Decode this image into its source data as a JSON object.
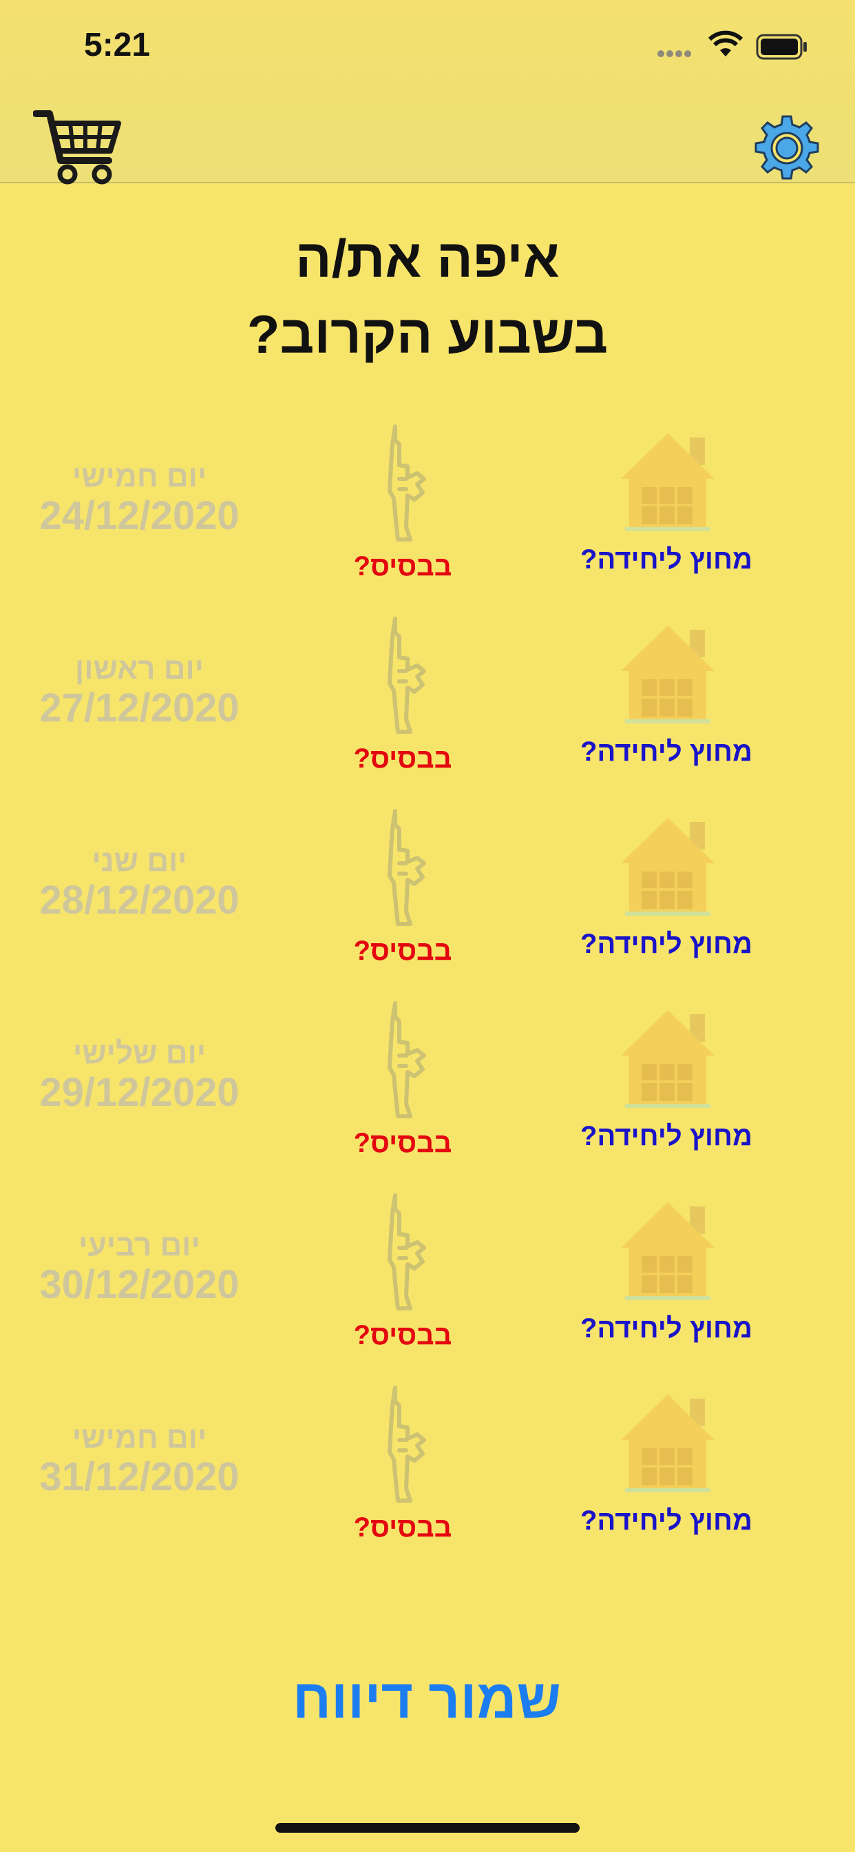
{
  "status_bar": {
    "time": "5:21"
  },
  "nav": {
    "cart_icon": "cart-icon",
    "settings_icon": "gear-icon"
  },
  "title": {
    "line1": "איפה את/ה",
    "line2": "בשבוע הקרוב?"
  },
  "rows": [
    {
      "day": "יום חמישי",
      "date": "24/12/2020",
      "base": "בבסיס?",
      "home": "מחוץ ליחידה?"
    },
    {
      "day": "יום ראשון",
      "date": "27/12/2020",
      "base": "בבסיס?",
      "home": "מחוץ ליחידה?"
    },
    {
      "day": "יום שני",
      "date": "28/12/2020",
      "base": "בבסיס?",
      "home": "מחוץ ליחידה?"
    },
    {
      "day": "יום שלישי",
      "date": "29/12/2020",
      "base": "בבסיס?",
      "home": "מחוץ ליחידה?"
    },
    {
      "day": "יום רביעי",
      "date": "30/12/2020",
      "base": "בבסיס?",
      "home": "מחוץ ליחידה?"
    },
    {
      "day": "יום חמישי",
      "date": "31/12/2020",
      "base": "בבסיס?",
      "home": "מחוץ ליחידה?"
    }
  ],
  "save_button": "שמור דיווח",
  "colors": {
    "background": "#f7e46a",
    "base_text": "#e3050f",
    "home_text": "#1914c8",
    "save_button": "#1c7df0",
    "date_text": "#cfc79b"
  }
}
